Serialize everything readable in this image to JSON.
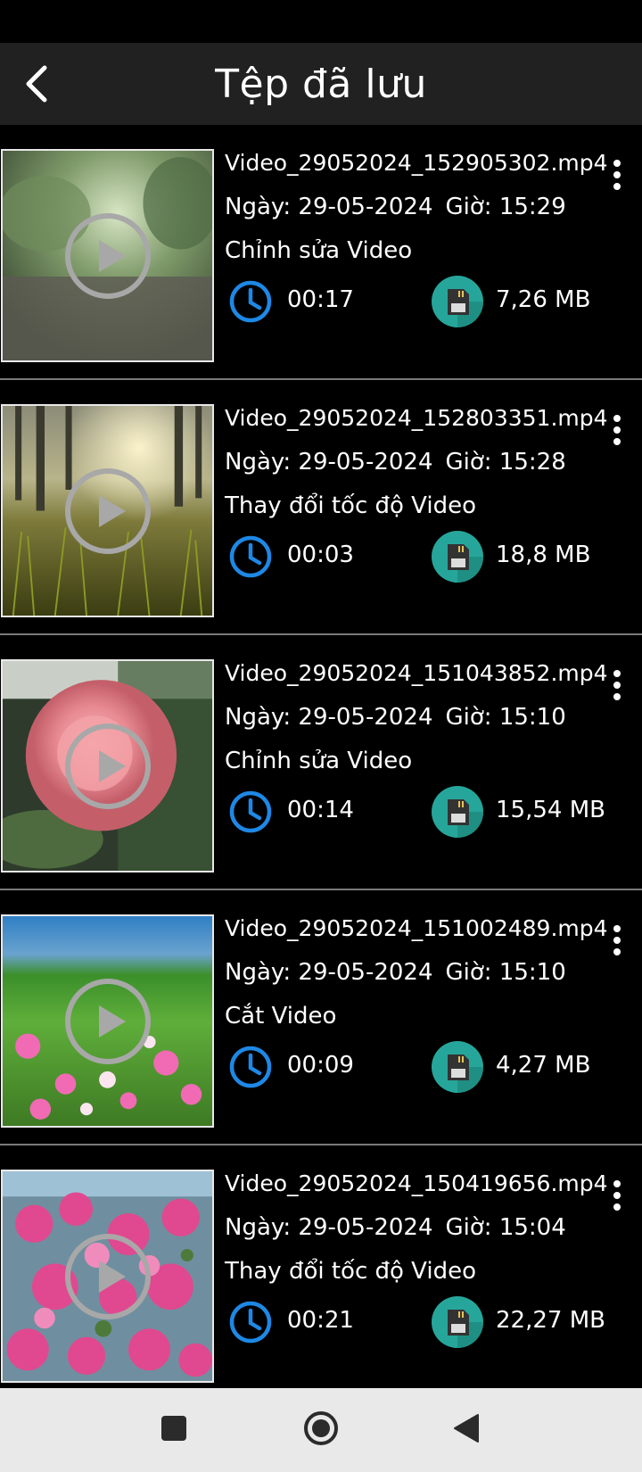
{
  "header": {
    "title": "Tệp đã lưu"
  },
  "items": [
    {
      "filename": "Video_29052024_152905302.mp4",
      "date_label": "Ngày: 29-05-2024",
      "time_label": "Giờ: 15:29",
      "edit_type": "Chỉnh sửa Video",
      "duration": "00:17",
      "size": "7,26 MB"
    },
    {
      "filename": "Video_29052024_152803351.mp4",
      "date_label": "Ngày: 29-05-2024",
      "time_label": "Giờ: 15:28",
      "edit_type": "Thay đổi tốc độ Video",
      "duration": "00:03",
      "size": "18,8 MB"
    },
    {
      "filename": "Video_29052024_151043852.mp4",
      "date_label": "Ngày: 29-05-2024",
      "time_label": "Giờ: 15:10",
      "edit_type": "Chỉnh sửa Video",
      "duration": "00:14",
      "size": "15,54 MB"
    },
    {
      "filename": "Video_29052024_151002489.mp4",
      "date_label": "Ngày: 29-05-2024",
      "time_label": "Giờ: 15:10",
      "edit_type": "Cắt Video",
      "duration": "00:09",
      "size": "4,27 MB"
    },
    {
      "filename": "Video_29052024_150419656.mp4",
      "date_label": "Ngày: 29-05-2024",
      "time_label": "Giờ: 15:04",
      "edit_type": "Thay đổi tốc độ Video",
      "duration": "00:21",
      "size": "22,27 MB"
    }
  ],
  "icons": {
    "duration": "clock-icon",
    "size": "sd-card-icon",
    "more": "more-vert-icon",
    "back": "back-arrow-icon"
  },
  "colors": {
    "app_bar": "#212121",
    "clock_blue": "#1e88e5",
    "sd_teal": "#26a69a",
    "divider": "#7a7a7a"
  }
}
